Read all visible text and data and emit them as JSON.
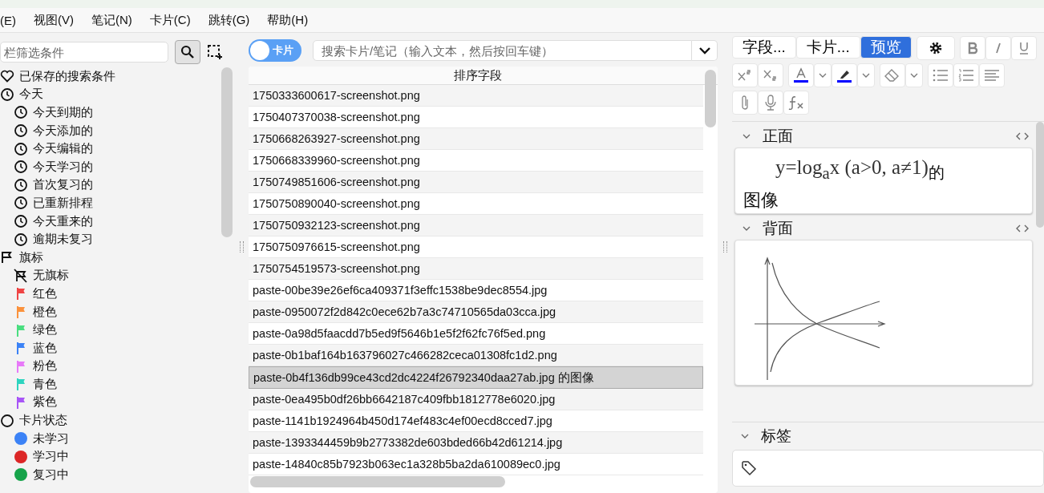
{
  "menu": [
    "(E)",
    "视图(V)",
    "笔记(N)",
    "卡片(C)",
    "跳转(G)",
    "帮助(H)"
  ],
  "sidebar": {
    "search": {
      "placeholder": "栏筛选条件"
    },
    "items": [
      {
        "kind": "saved",
        "label": "已保存的搜索条件"
      },
      {
        "kind": "clock",
        "label": "今天",
        "children": [
          {
            "kind": "clock",
            "label": "今天到期的"
          },
          {
            "kind": "clock",
            "label": "今天添加的"
          },
          {
            "kind": "clock",
            "label": "今天编辑的"
          },
          {
            "kind": "clock",
            "label": "今天学习的"
          },
          {
            "kind": "clock",
            "label": "首次复习的"
          },
          {
            "kind": "clock",
            "label": "已重新排程"
          },
          {
            "kind": "clock",
            "label": "今天重来的"
          },
          {
            "kind": "clock",
            "label": "逾期未复习"
          }
        ]
      },
      {
        "kind": "flagset",
        "label": "旗标",
        "children": [
          {
            "kind": "noflag",
            "label": "无旗标"
          },
          {
            "kind": "flag",
            "label": "红色",
            "color": "#ef4444"
          },
          {
            "kind": "flag",
            "label": "橙色",
            "color": "#fb923c"
          },
          {
            "kind": "flag",
            "label": "绿色",
            "color": "#4ade80"
          },
          {
            "kind": "flag",
            "label": "蓝色",
            "color": "#3b82f6"
          },
          {
            "kind": "flag",
            "label": "粉色",
            "color": "#e879f9"
          },
          {
            "kind": "flag",
            "label": "青色",
            "color": "#2dd4bf"
          },
          {
            "kind": "flag",
            "label": "紫色",
            "color": "#a855f7"
          }
        ]
      },
      {
        "kind": "state",
        "label": "卡片状态",
        "children": [
          {
            "kind": "dot",
            "label": "未学习",
            "color": "#3b82f6"
          },
          {
            "kind": "dot",
            "label": "学习中",
            "color": "#dc2626"
          },
          {
            "kind": "dot",
            "label": "复习中",
            "color": "#16a34a"
          }
        ]
      }
    ]
  },
  "toggle": {
    "label": "卡片"
  },
  "search": {
    "placeholder": "搜索卡片/笔记（输入文本，然后按回车键）"
  },
  "table": {
    "columns": [
      "排序字段"
    ],
    "rows": [
      {
        "cell": "1750333600617-screenshot.png",
        "selected": false
      },
      {
        "cell": "1750407370038-screenshot.png",
        "selected": false
      },
      {
        "cell": "1750668263927-screenshot.png",
        "selected": false
      },
      {
        "cell": "1750668339960-screenshot.png",
        "selected": false
      },
      {
        "cell": "1750749851606-screenshot.png",
        "selected": false
      },
      {
        "cell": "1750750890040-screenshot.png",
        "selected": false
      },
      {
        "cell": "1750750932123-screenshot.png",
        "selected": false
      },
      {
        "cell": "1750750976615-screenshot.png",
        "selected": false
      },
      {
        "cell": "1750754519573-screenshot.png",
        "selected": false
      },
      {
        "cell": "paste-00be39e26ef6ca409371f3effc1538be9dec8554.jpg",
        "selected": false
      },
      {
        "cell": "paste-0950072f2d842c0ece62b7a3c74710565da03cca.jpg",
        "selected": false
      },
      {
        "cell": "paste-0a98d5faacdd7b5ed9f5646b1e5f2f62fc76f5ed.png",
        "selected": false
      },
      {
        "cell": "paste-0b1baf164b163796027c466282ceca01308fc1d2.png",
        "selected": false
      },
      {
        "cell": "paste-0b4f136db99ce43cd2dc4224f26792340daa27ab.jpg 的图像",
        "selected": true
      },
      {
        "cell": "paste-0ea495b0df26bb6642187c409fbb1812778e6020.jpg",
        "selected": false
      },
      {
        "cell": "paste-1141b1924964b450d174ef483c4ef00ecd8cced7.jpg",
        "selected": false
      },
      {
        "cell": "paste-1393344459b9b2773382de603bded66b42d61214.jpg",
        "selected": false
      },
      {
        "cell": "paste-14840c85b7923b063ec1a328b5ba2da610089ec0.jpg",
        "selected": false
      }
    ]
  },
  "editor": {
    "modes": [
      {
        "label": "字段...",
        "selected": false
      },
      {
        "label": "卡片...",
        "selected": false
      },
      {
        "label": "预览",
        "selected": true
      }
    ],
    "fields": [
      {
        "name": "正面",
        "kind": "text",
        "formula": "y=log$_{a}$x (a>0, a≠1)",
        "suffix": "的",
        "text": "图像"
      },
      {
        "name": "背面",
        "kind": "graph"
      }
    ],
    "tags_label": "标签"
  }
}
